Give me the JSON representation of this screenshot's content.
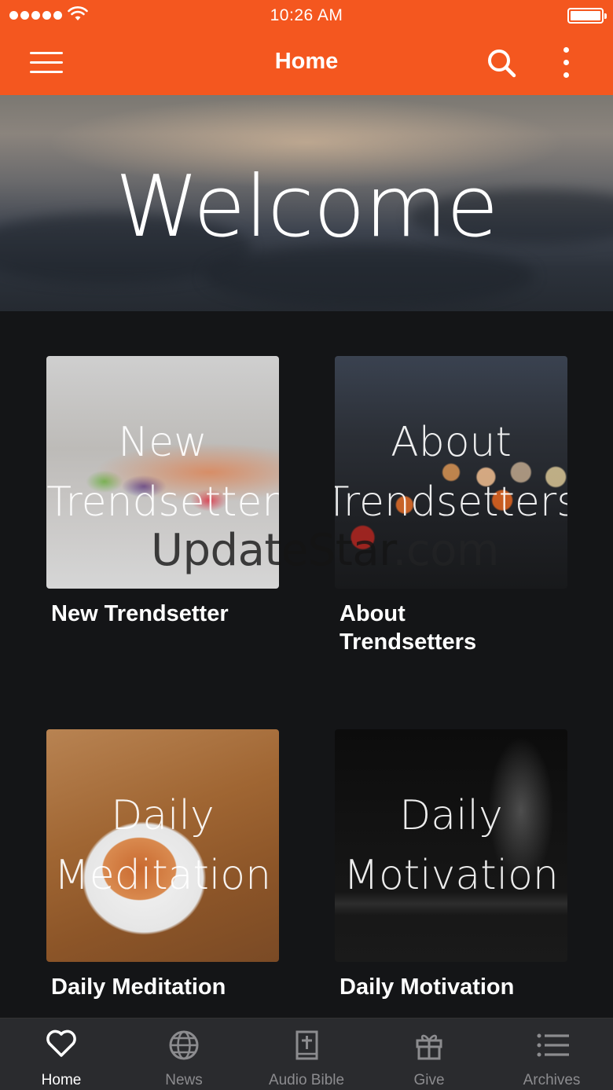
{
  "status_bar": {
    "time": "10:26 AM"
  },
  "app_bar": {
    "title": "Home",
    "menu_icon": "hamburger-icon",
    "search_icon": "search-icon",
    "more_icon": "more-vertical-icon"
  },
  "banner": {
    "heading": "Welcome"
  },
  "tiles": [
    {
      "overlay_lines": [
        "New",
        "Trendsetter"
      ],
      "caption_lines": [
        "New Trendsetter"
      ]
    },
    {
      "overlay_lines": [
        "About",
        "Trendsetters"
      ],
      "caption_lines": [
        "About",
        "Trendsetters"
      ]
    },
    {
      "overlay_lines": [
        "Daily",
        "Meditation"
      ],
      "caption_lines": [
        "Daily Meditation"
      ]
    },
    {
      "overlay_lines": [
        "Daily",
        "Motivation"
      ],
      "caption_lines": [
        "Daily Motivation"
      ]
    }
  ],
  "watermark": {
    "main": "UpdateStar",
    "suffix": ".com"
  },
  "tab_bar": {
    "tabs": [
      {
        "label": "Home",
        "icon": "heart-icon",
        "active": true
      },
      {
        "label": "News",
        "icon": "globe-icon",
        "active": false
      },
      {
        "label": "Audio Bible",
        "icon": "bible-icon",
        "active": false
      },
      {
        "label": "Give",
        "icon": "gift-icon",
        "active": false
      },
      {
        "label": "Archives",
        "icon": "list-icon",
        "active": false
      }
    ]
  },
  "colors": {
    "accent": "#f4571f",
    "background": "#141517",
    "tab_bar": "#2a2b2e",
    "tab_inactive": "#8c8c8f"
  }
}
